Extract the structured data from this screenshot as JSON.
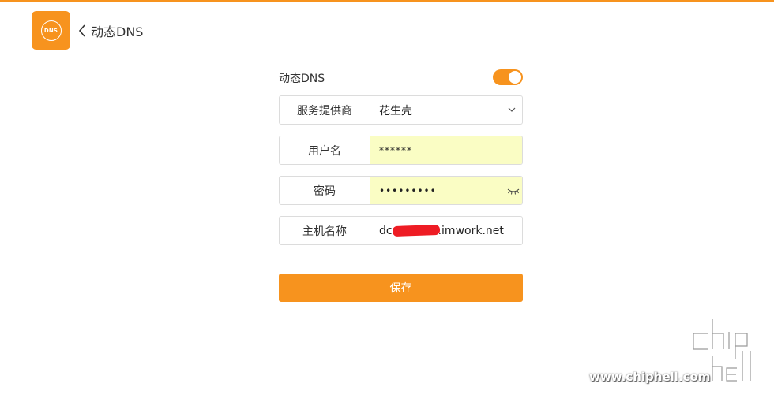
{
  "header": {
    "app_icon_text": "DNS",
    "title": "动态DNS"
  },
  "form": {
    "toggle": {
      "label": "动态DNS",
      "enabled": true
    },
    "provider": {
      "label": "服务提供商",
      "value": "花生壳"
    },
    "username": {
      "label": "用户名",
      "value": "******"
    },
    "password": {
      "label": "密码",
      "value": "•••••••••"
    },
    "hostname": {
      "label": "主机名称",
      "value_prefix": "dc",
      "value_suffix": ".imwork.net"
    },
    "save_label": "保存"
  },
  "watermark": {
    "url": "www.chiphell.com",
    "logo_text": "chip hell"
  },
  "colors": {
    "accent": "#f7931e",
    "autofill": "#fafdc4",
    "redaction": "#ee1c24"
  }
}
